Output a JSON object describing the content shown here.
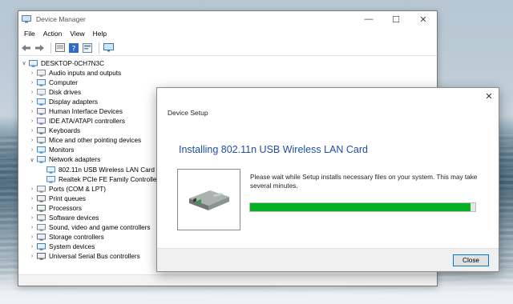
{
  "device_manager": {
    "title": "Device Manager",
    "window_buttons": {
      "minimize": "—",
      "maximize": "☐",
      "close": "✕"
    },
    "menu": [
      "File",
      "Action",
      "View",
      "Help"
    ],
    "toolbar_icons": [
      "back-arrow-icon",
      "forward-arrow-icon",
      "properties-icon",
      "help-icon",
      "update-driver-icon",
      "monitor-icon"
    ],
    "tree": [
      {
        "label": "DESKTOP-0CH7N3C",
        "level": 0,
        "toggle": "∨",
        "icon": "computer-icon"
      },
      {
        "label": "Audio inputs and outputs",
        "level": 1,
        "toggle": "›",
        "icon": "speaker-icon"
      },
      {
        "label": "Computer",
        "level": 1,
        "toggle": "›",
        "icon": "computer-icon"
      },
      {
        "label": "Disk drives",
        "level": 1,
        "toggle": "›",
        "icon": "disk-icon"
      },
      {
        "label": "Display adapters",
        "level": 1,
        "toggle": "›",
        "icon": "display-icon"
      },
      {
        "label": "Human Interface Devices",
        "level": 1,
        "toggle": "›",
        "icon": "hid-icon"
      },
      {
        "label": "IDE ATA/ATAPI controllers",
        "level": 1,
        "toggle": "›",
        "icon": "ide-icon"
      },
      {
        "label": "Keyboards",
        "level": 1,
        "toggle": "›",
        "icon": "keyboard-icon"
      },
      {
        "label": "Mice and other pointing devices",
        "level": 1,
        "toggle": "›",
        "icon": "mouse-icon"
      },
      {
        "label": "Monitors",
        "level": 1,
        "toggle": "›",
        "icon": "monitor-icon"
      },
      {
        "label": "Network adapters",
        "level": 1,
        "toggle": "∨",
        "icon": "network-icon"
      },
      {
        "label": "802.11n USB Wireless LAN Card",
        "level": 2,
        "toggle": "",
        "icon": "network-icon"
      },
      {
        "label": "Realtek PCIe FE Family Controller",
        "level": 2,
        "toggle": "",
        "icon": "network-icon"
      },
      {
        "label": "Ports (COM & LPT)",
        "level": 1,
        "toggle": "›",
        "icon": "port-icon"
      },
      {
        "label": "Print queues",
        "level": 1,
        "toggle": "›",
        "icon": "printer-icon"
      },
      {
        "label": "Processors",
        "level": 1,
        "toggle": "›",
        "icon": "processor-icon"
      },
      {
        "label": "Software devices",
        "level": 1,
        "toggle": "›",
        "icon": "software-icon"
      },
      {
        "label": "Sound, video and game controllers",
        "level": 1,
        "toggle": "›",
        "icon": "sound-icon"
      },
      {
        "label": "Storage controllers",
        "level": 1,
        "toggle": "›",
        "icon": "storage-icon"
      },
      {
        "label": "System devices",
        "level": 1,
        "toggle": "›",
        "icon": "system-icon"
      },
      {
        "label": "Universal Serial Bus controllers",
        "level": 1,
        "toggle": "›",
        "icon": "usb-icon"
      }
    ]
  },
  "setup_dialog": {
    "title": "Device Setup",
    "close_glyph": "✕",
    "heading": "Installing 802.11n USB Wireless LAN Card",
    "message": "Please wait while Setup installs necessary files on your system. This may take several minutes.",
    "progress_fraction": 0.98,
    "close_button": "Close",
    "device_icon": "usb-adapter-icon"
  },
  "colors": {
    "accent": "#0078d7",
    "heading_blue": "#1f4ea3",
    "progress_green": "#06b025"
  }
}
